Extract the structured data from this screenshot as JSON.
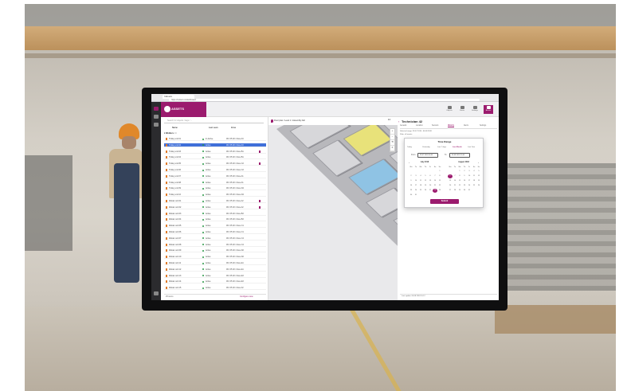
{
  "browser": {
    "tab_label": "Indoors",
    "url": "https://indoors.io/dashboard"
  },
  "app": {
    "brand": "ASSETS",
    "header_icons": [
      {
        "label": "Objects",
        "icon": "cube-icon"
      },
      {
        "label": "Zones",
        "icon": "zone-icon"
      },
      {
        "label": "Settings",
        "icon": "gear-icon"
      },
      {
        "label": "Assets",
        "icon": "tag-icon"
      }
    ],
    "accent": "#9b1b6e"
  },
  "list": {
    "search_placeholder": "Search for objects / tags / ...",
    "columns": [
      "Name",
      "Last seen",
      "Zone"
    ],
    "group": "Welders",
    "group_count": "24",
    "rows": [
      {
        "name": "Trolley unit 01",
        "status": "In-Active",
        "time": "06 / 05 18 / Zone A3",
        "flag": false
      },
      {
        "name": "Trolley unit 02",
        "status": "Active",
        "time": "06 / 05 18 / Zone A3",
        "flag": false
      },
      {
        "name": "Trolley unit 03",
        "status": "Active",
        "time": "06 / 05 18 / Zone B1",
        "flag": true
      },
      {
        "name": "Trolley unit 04",
        "status": "Active",
        "time": "06 / 05 18 / Zone B1",
        "flag": false
      },
      {
        "name": "Trolley unit 05",
        "status": "Active",
        "time": "06 / 05 18 / Zone C2",
        "flag": true
      },
      {
        "name": "Trolley unit 06",
        "status": "Active",
        "time": "06 / 05 18 / Zone C2",
        "flag": false
      },
      {
        "name": "Trolley unit 07",
        "status": "Active",
        "time": "06 / 05 18 / Zone A1",
        "flag": false
      },
      {
        "name": "Trolley unit 08",
        "status": "Active",
        "time": "06 / 05 18 / Zone A1",
        "flag": false
      },
      {
        "name": "Trolley unit 09",
        "status": "Active",
        "time": "06 / 05 18 / Zone D4",
        "flag": false
      },
      {
        "name": "Trolley unit 10",
        "status": "Active",
        "time": "06 / 05 18 / Zone D4",
        "flag": false
      },
      {
        "name": "Welder unit 01",
        "status": "Active",
        "time": "06 / 05 18 / Zone A2",
        "flag": true
      },
      {
        "name": "Welder unit 02",
        "status": "Active",
        "time": "06 / 05 18 / Zone A2",
        "flag": true
      },
      {
        "name": "Welder unit 03",
        "status": "Active",
        "time": "06 / 05 18 / Zone B3",
        "flag": false
      },
      {
        "name": "Welder unit 04",
        "status": "Active",
        "time": "06 / 05 18 / Zone B3",
        "flag": false
      },
      {
        "name": "Welder unit 05",
        "status": "Active",
        "time": "06 / 05 18 / Zone C1",
        "flag": false
      },
      {
        "name": "Welder unit 06",
        "status": "Active",
        "time": "06 / 05 18 / Zone C1",
        "flag": false
      },
      {
        "name": "Welder unit 07",
        "status": "Active",
        "time": "06 / 05 18 / Zone C4",
        "flag": false
      },
      {
        "name": "Welder unit 08",
        "status": "Active",
        "time": "06 / 05 18 / Zone C4",
        "flag": false
      },
      {
        "name": "Welder unit 09",
        "status": "Active",
        "time": "06 / 05 18 / Zone D2",
        "flag": false
      },
      {
        "name": "Welder unit 10",
        "status": "Active",
        "time": "06 / 05 18 / Zone D2",
        "flag": false
      },
      {
        "name": "Welder unit 11",
        "status": "Active",
        "time": "06 / 05 18 / Zone E1",
        "flag": false
      },
      {
        "name": "Welder unit 12",
        "status": "Active",
        "time": "06 / 05 18 / Zone E1",
        "flag": false
      },
      {
        "name": "Welder unit 13",
        "status": "Active",
        "time": "06 / 05 18 / Zone E3",
        "flag": false
      },
      {
        "name": "Welder unit 14",
        "status": "Active",
        "time": "06 / 05 18 / Zone E3",
        "flag": false
      },
      {
        "name": "Welder unit 15",
        "status": "Active",
        "time": "06 / 05 18 / Zone F2",
        "flag": false
      }
    ],
    "footer_count": "25 items",
    "footer_action": "Configure view"
  },
  "map": {
    "location": "Floor plan / Level 1 / Assembly hall",
    "floor": "L1"
  },
  "detail": {
    "title": "Technician 42",
    "tabs": [
      "General",
      "Location",
      "Sensors",
      "History",
      "Alerts",
      "Settings"
    ],
    "active_tab": "History",
    "fields": [
      "Selected range: 28.07.2018 - 06.08.2018",
      "Filter: all events"
    ],
    "footer": "Last update: 06.08.2018 10:12"
  },
  "modal": {
    "title": "Time Range",
    "tabs": [
      "Today",
      "Yesterday",
      "Last 7 days",
      "Last Month",
      "Last Year"
    ],
    "active_tab": "Last Month",
    "from_label": "From",
    "from_value": "28.07.2018 00:00",
    "to_label": "To",
    "to_value": "06.08.2018 10:00",
    "left_month": "July 2018",
    "right_month": "August 2018",
    "weekdays": [
      "Mo",
      "Tu",
      "We",
      "Th",
      "Fr",
      "Sa",
      "Su"
    ],
    "submit": "Submit"
  }
}
